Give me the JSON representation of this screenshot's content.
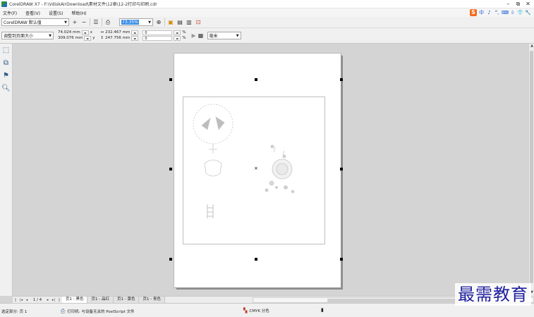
{
  "window": {
    "title": "CorelDRAW X7 - F:\\VdiskAirDownload\\素材文件\\12章\\12-2打印与印刷.cdr",
    "controls": [
      "–",
      "⧉",
      "✕"
    ]
  },
  "menu": [
    "文件(F)",
    "查看(V)",
    "设置(S)",
    "帮助(H)"
  ],
  "ime": {
    "logo": "S",
    "items": [
      "中",
      "♪",
      "°,",
      "⌨",
      "⇩",
      "👕",
      "🔧"
    ]
  },
  "toolbar": {
    "preset": "CorelDRAW 默认值",
    "zoom_value": "73.35%"
  },
  "propbar": {
    "fit_mode": "调整到页面大小",
    "pos_x": "74.024 mm",
    "pos_y": "309.076 mm",
    "width": "232.467 mm",
    "height": "247.756 mm",
    "scale_w": "0",
    "scale_h": "0",
    "x_label": "x",
    "y_label": "y",
    "percent": "%",
    "unit": "毫米"
  },
  "pagebar": {
    "page_count": "1 / 4",
    "tabs": [
      "页1 - 黑色",
      "页1 - 品红",
      "页1 - 黄色",
      "页1 - 青色"
    ]
  },
  "status": {
    "selection": "选定部分: 页 1",
    "printer": "打印机: 与设备无关的 PostScript 文件",
    "color_mode": "CMYK 分色"
  },
  "watermark": "最需教育"
}
